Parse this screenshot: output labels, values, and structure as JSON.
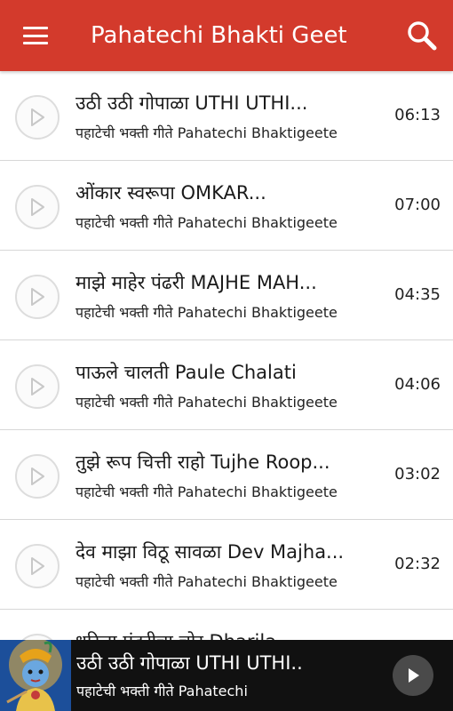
{
  "appbar": {
    "title": "Pahatechi Bhakti Geet",
    "menu_icon": "hamburger-menu-icon",
    "search_icon": "search-icon",
    "color": "#d33a2c"
  },
  "songs": [
    {
      "title": "उठी उठी गोपाळा UTHI UTHI...",
      "subtitle": "पहाटेची भक्ती गीते Pahatechi Bhaktigeete",
      "duration": "06:13"
    },
    {
      "title": "ओंकार स्वरूपा OMKAR...",
      "subtitle": "पहाटेची भक्ती गीते Pahatechi Bhaktigeete",
      "duration": "07:00"
    },
    {
      "title": "माझे माहेर पंढरी MAJHE MAH...",
      "subtitle": "पहाटेची भक्ती गीते Pahatechi Bhaktigeete",
      "duration": "04:35"
    },
    {
      "title": "पाऊले चालती Paule Chalati",
      "subtitle": "पहाटेची भक्ती गीते Pahatechi Bhaktigeete",
      "duration": "04:06"
    },
    {
      "title": "तुझे रूप चित्ती राहो Tujhe Roop...",
      "subtitle": "पहाटेची भक्ती गीते Pahatechi Bhaktigeete",
      "duration": "03:02"
    },
    {
      "title": "देव माझा विठू सावळा Dev Majha...",
      "subtitle": "पहाटेची भक्ती गीते Pahatechi Bhaktigeete",
      "duration": "02:32"
    },
    {
      "title": "धरिला पंढरीचा चोर Dharila",
      "subtitle": "",
      "duration": ""
    }
  ],
  "player": {
    "title": "उठी उठी गोपाळा UTHI UTHI..",
    "subtitle": "पहाटेची भक्ती गीते Pahatechi",
    "play_icon": "play-icon",
    "cover": "krishna-cover-art"
  }
}
